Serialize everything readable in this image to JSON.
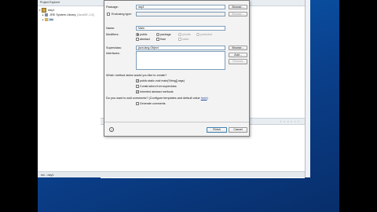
{
  "explorer": {
    "tab_label": "Project Explorer",
    "tree": [
      {
        "label": "day1",
        "level": 0
      },
      {
        "label": "JRE System Library",
        "suffix": "[JavaSE-1.8]",
        "level": 1
      },
      {
        "label": "src",
        "level": 1
      }
    ]
  },
  "status_bar": {
    "text": "src - day1"
  },
  "console": {
    "toolbar_icons": "▫ ▫ ▫ ▫ ▫ ▫"
  },
  "dialog": {
    "enclosing_type_label": "Enclosing type:",
    "package_label": "Package:",
    "package_value": "day1",
    "browse_label": "Browse...",
    "browse2_label": "Browse...",
    "name_label": "Name:",
    "name_value": "Main",
    "modifiers_label": "Modifiers:",
    "modifiers": {
      "public": "public",
      "package": "package",
      "private": "private",
      "protected": "protected",
      "abstract": "abstract",
      "final": "final",
      "static": "static"
    },
    "superclass_label": "Superclass:",
    "superclass_value": "java.lang.Object",
    "browse3_label": "Browse...",
    "interfaces_label": "Interfaces:",
    "add_label": "Add...",
    "remove_label": "Remove",
    "stubs_question": "Which method stubs would you like to create?",
    "stubs": {
      "main": "public static void main(String[] args)",
      "constructors": "Constructors from superclass",
      "inherited": "Inherited abstract methods"
    },
    "comments_question": "Do you want to add comments? (Configure templates and default value ",
    "comments_link": "here",
    "comments_question_end": ")",
    "generate_comments": "Generate comments",
    "help_symbol": "?",
    "finish_label": "Finish",
    "cancel_label": "Cancel"
  }
}
